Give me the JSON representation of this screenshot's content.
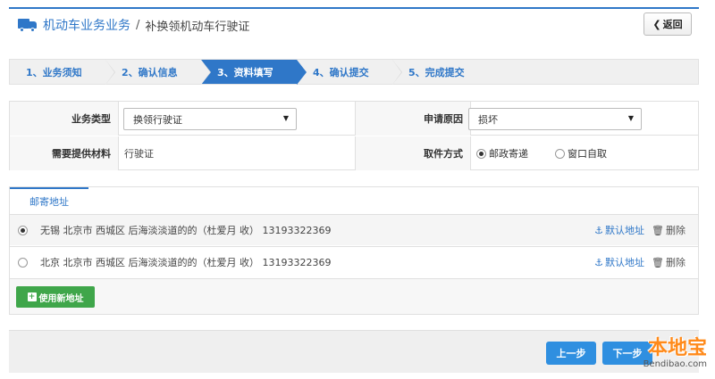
{
  "header": {
    "title": "机动车业务业务",
    "separator": "/",
    "subtitle": "补换领机动车行驶证",
    "back_label": "返回",
    "brand_color": "#2f77c8"
  },
  "steps": [
    {
      "label": "1、业务须知",
      "active": false
    },
    {
      "label": "2、确认信息",
      "active": false
    },
    {
      "label": "3、资料填写",
      "active": true
    },
    {
      "label": "4、确认提交",
      "active": false
    },
    {
      "label": "5、完成提交",
      "active": false
    }
  ],
  "form": {
    "business_type_label": "业务类型",
    "business_type_value": "换领行驶证",
    "reason_label": "申请原因",
    "reason_value": "损坏",
    "materials_label": "需要提供材料",
    "materials_value": "行驶证",
    "pickup_label": "取件方式",
    "pickup_options": [
      {
        "label": "邮政寄递",
        "checked": true
      },
      {
        "label": "窗口自取",
        "checked": false
      }
    ]
  },
  "address": {
    "tab_label": "邮寄地址",
    "rows": [
      {
        "text": "无锡 北京市 西城区 后海淡淡道的的（杜爱月 收） 13193322369",
        "selected": true
      },
      {
        "text": "北京 北京市 西城区 后海淡淡道的的（杜爱月 收） 13193322369",
        "selected": false
      }
    ],
    "default_label": "默认地址",
    "delete_label": "删除",
    "add_button_label": "使用新地址",
    "add_button_color": "#3fa64a"
  },
  "footer": {
    "prev_label": "上一步",
    "next_label": "下一步"
  },
  "watermark": {
    "top": "本地宝",
    "bottom": "Bendibao.com"
  }
}
